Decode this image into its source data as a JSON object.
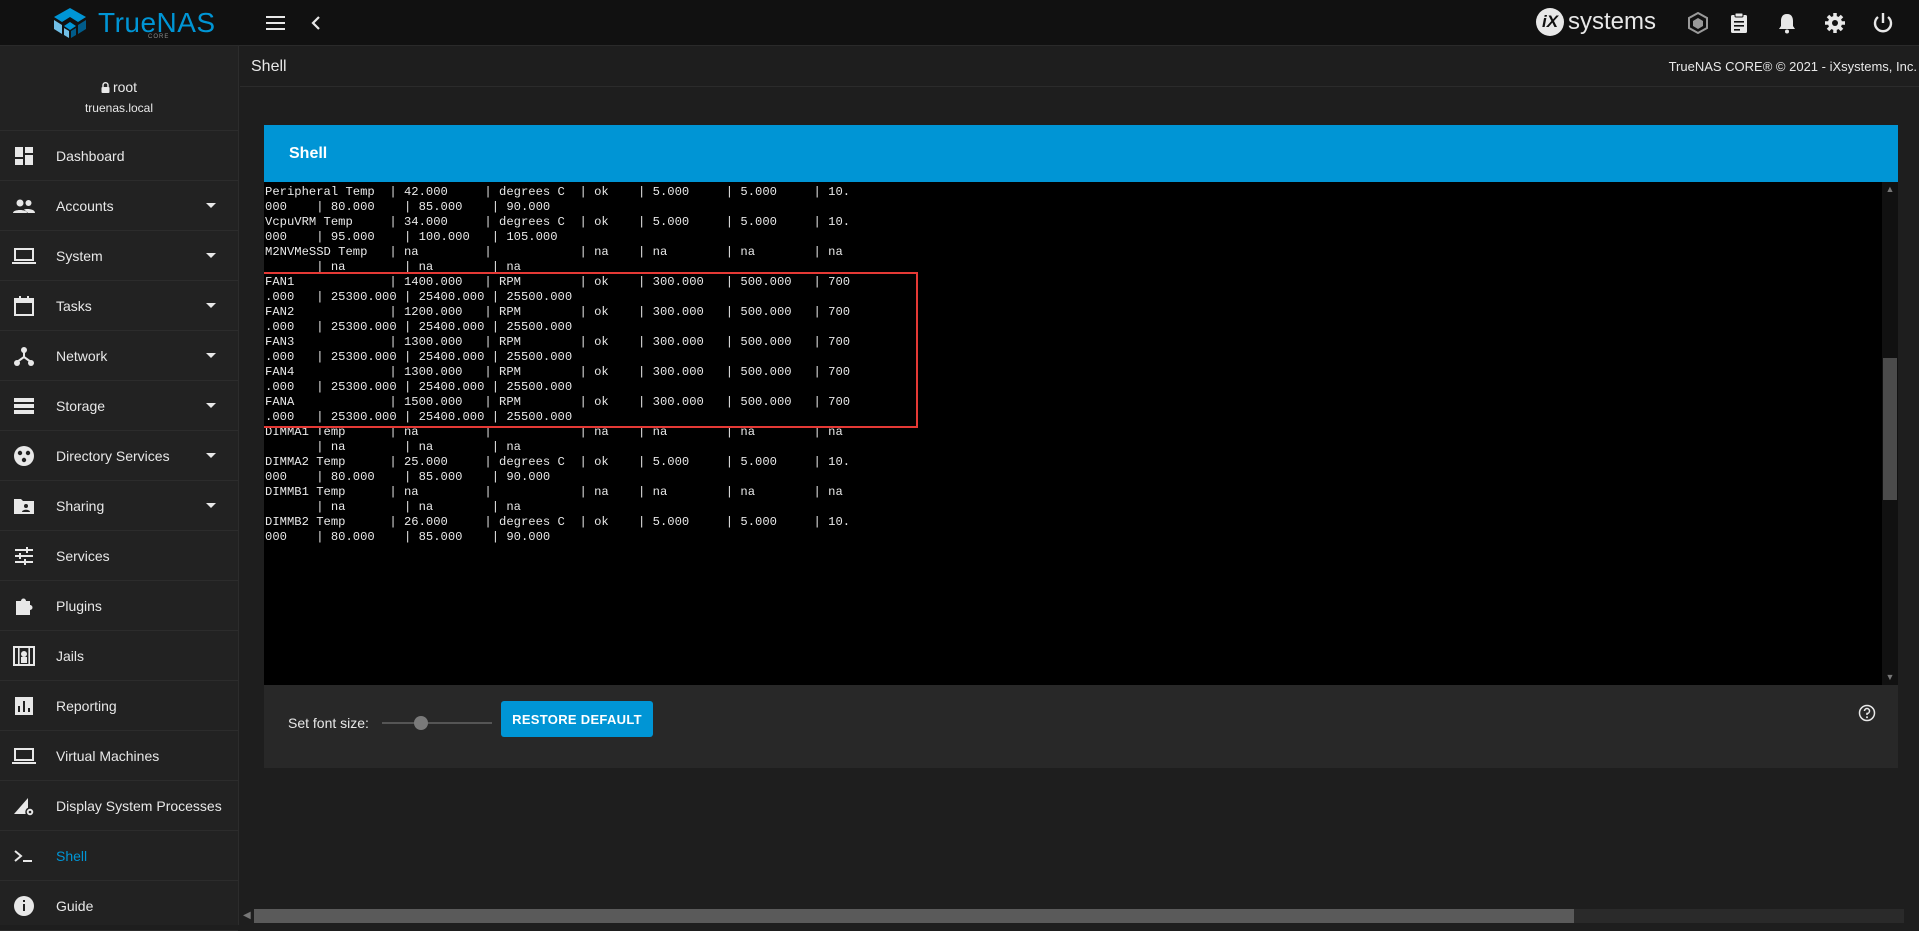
{
  "topbar": {
    "brand": "TrueNAS",
    "brand_sub": "CORE",
    "vendor": "systems",
    "vendor_mark": "iX",
    "icons": [
      "menu-icon",
      "back-chevron-icon",
      "truecommand-icon",
      "clipboard-icon",
      "bell-icon",
      "gear-icon",
      "power-icon"
    ]
  },
  "user": {
    "name": "root",
    "host": "truenas.local"
  },
  "sidebar": {
    "items": [
      {
        "label": "Dashboard",
        "icon": "dashboard-icon",
        "expandable": false
      },
      {
        "label": "Accounts",
        "icon": "accounts-icon",
        "expandable": true
      },
      {
        "label": "System",
        "icon": "laptop-icon",
        "expandable": true
      },
      {
        "label": "Tasks",
        "icon": "calendar-icon",
        "expandable": true
      },
      {
        "label": "Network",
        "icon": "network-icon",
        "expandable": true
      },
      {
        "label": "Storage",
        "icon": "storage-icon",
        "expandable": true
      },
      {
        "label": "Directory Services",
        "icon": "directory-icon",
        "expandable": true
      },
      {
        "label": "Sharing",
        "icon": "folder-share-icon",
        "expandable": true
      },
      {
        "label": "Services",
        "icon": "sliders-icon",
        "expandable": false
      },
      {
        "label": "Plugins",
        "icon": "puzzle-icon",
        "expandable": false
      },
      {
        "label": "Jails",
        "icon": "jail-icon",
        "expandable": false
      },
      {
        "label": "Reporting",
        "icon": "chart-icon",
        "expandable": false
      },
      {
        "label": "Virtual Machines",
        "icon": "laptop-icon",
        "expandable": false
      },
      {
        "label": "Display System Processes",
        "icon": "processes-icon",
        "expandable": false
      },
      {
        "label": "Shell",
        "icon": "terminal-icon",
        "expandable": false,
        "active": true
      },
      {
        "label": "Guide",
        "icon": "info-icon",
        "expandable": false
      }
    ]
  },
  "header": {
    "title": "Shell",
    "copyright": "TrueNAS CORE® © 2021 - iXsystems, Inc."
  },
  "shell": {
    "card_title": "Shell",
    "lines": [
      "Peripheral Temp  | 42.000     | degrees C  | ok    | 5.000     | 5.000     | 10.",
      "000    | 80.000    | 85.000    | 90.000",
      "VcpuVRM Temp     | 34.000     | degrees C  | ok    | 5.000     | 5.000     | 10.",
      "000    | 95.000    | 100.000   | 105.000",
      "M2NVMeSSD Temp   | na         |            | na    | na        | na        | na",
      "       | na        | na        | na",
      "FAN1             | 1400.000   | RPM        | ok    | 300.000   | 500.000   | 700",
      ".000   | 25300.000 | 25400.000 | 25500.000",
      "FAN2             | 1200.000   | RPM        | ok    | 300.000   | 500.000   | 700",
      ".000   | 25300.000 | 25400.000 | 25500.000",
      "FAN3             | 1300.000   | RPM        | ok    | 300.000   | 500.000   | 700",
      ".000   | 25300.000 | 25400.000 | 25500.000",
      "FAN4             | 1300.000   | RPM        | ok    | 300.000   | 500.000   | 700",
      ".000   | 25300.000 | 25400.000 | 25500.000",
      "FANA             | 1500.000   | RPM        | ok    | 300.000   | 500.000   | 700",
      ".000   | 25300.000 | 25400.000 | 25500.000",
      "DIMMA1 Temp      | na         |            | na    | na        | na        | na",
      "       | na        | na        | na",
      "DIMMA2 Temp      | 25.000     | degrees C  | ok    | 5.000     | 5.000     | 10.",
      "000    | 80.000    | 85.000    | 90.000",
      "DIMMB1 Temp      | na         |            | na    | na        | na        | na",
      "       | na        | na        | na",
      "DIMMB2 Temp      | 26.000     | degrees C  | ok    | 5.000     | 5.000     | 10.",
      "000    | 80.000    | 85.000    | 90.000"
    ],
    "font_size_label": "Set font size:",
    "restore_label": "RESTORE DEFAULT",
    "font_slider_level": 0.35
  },
  "colors": {
    "accent": "#0095d5",
    "highlight": "#e53935",
    "bg": "#1e1e1e"
  }
}
